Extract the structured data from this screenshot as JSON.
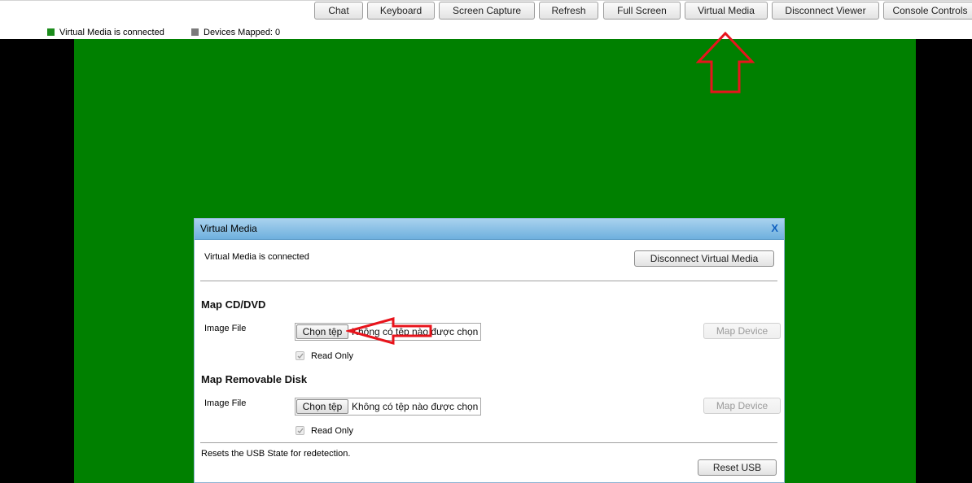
{
  "toolbar": {
    "chat": "Chat",
    "keyboard": "Keyboard",
    "screen_capture": "Screen Capture",
    "refresh": "Refresh",
    "full_screen": "Full Screen",
    "virtual_media": "Virtual Media",
    "disconnect_viewer": "Disconnect Viewer",
    "console_controls": "Console Controls"
  },
  "status_bar": {
    "vm_status": "Virtual Media is connected",
    "devices_mapped": "Devices Mapped: 0"
  },
  "colors": {
    "viewer_background": "#008000",
    "status_connected": "#1c8c1c",
    "annotation_arrow": "#e8141c"
  },
  "dialog": {
    "title": "Virtual Media",
    "close": "X",
    "connection_status": "Virtual Media is connected",
    "disconnect_button": "Disconnect Virtual Media",
    "cd_dvd": {
      "heading": "Map CD/DVD",
      "image_file_label": "Image File",
      "choose_button": "Chọn tệp",
      "file_status": "Không có tệp nào được chọn",
      "read_only_label": "Read Only",
      "map_button": "Map Device"
    },
    "removable": {
      "heading": "Map Removable Disk",
      "image_file_label": "Image File",
      "choose_button": "Chọn tệp",
      "file_status": "Không có tệp nào được chọn",
      "read_only_label": "Read Only",
      "map_button": "Map Device"
    },
    "reset_note": "Resets the USB State for redetection.",
    "reset_button": "Reset USB"
  },
  "annotations": {
    "up_arrow_icon": "arrow-up-outline",
    "left_arrow_icon": "arrow-left-outline"
  }
}
